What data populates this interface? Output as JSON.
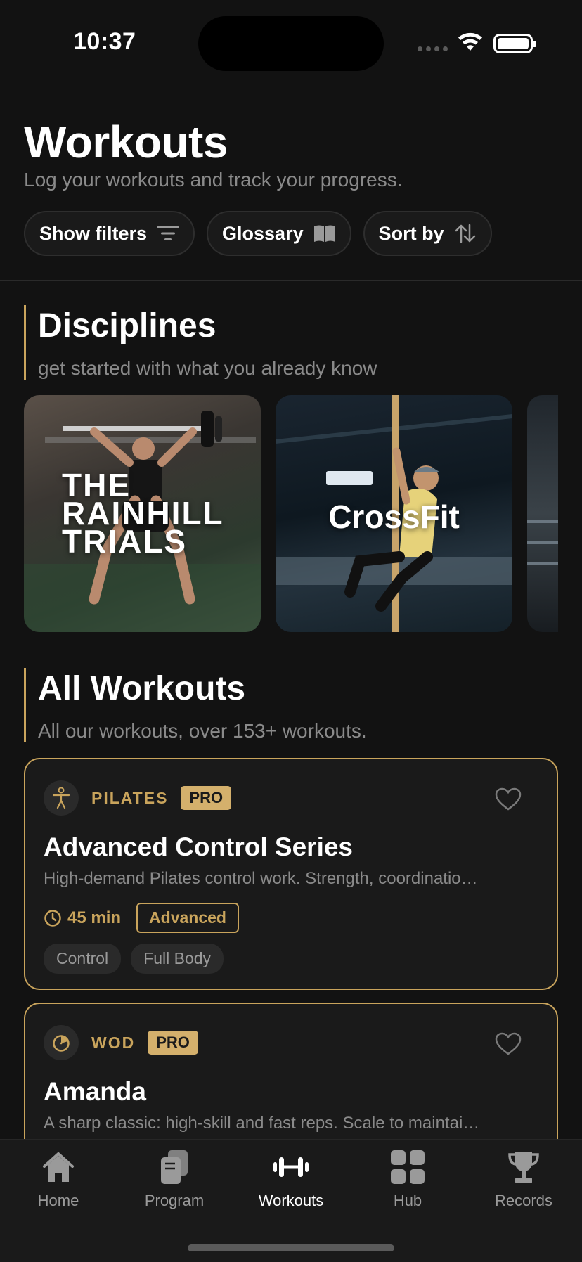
{
  "status_bar": {
    "time": "10:37"
  },
  "header": {
    "title": "Workouts",
    "subtitle": "Log your workouts and track your progress."
  },
  "filters": {
    "show_filters": "Show filters",
    "glossary": "Glossary",
    "sort_by": "Sort by"
  },
  "disciplines": {
    "title": "Disciplines",
    "subtitle": "get started with what you already know",
    "cards": [
      {
        "title": "THE RAINHILL TRIALS"
      },
      {
        "title": "CrossFit"
      }
    ]
  },
  "all_workouts": {
    "title": "All Workouts",
    "subtitle": "All our workouts, over 153+ workouts.",
    "items": [
      {
        "category": "PILATES",
        "badge": "PRO",
        "title": "Advanced Control Series",
        "description": "High-demand Pilates control work. Strength, coordinatio…",
        "duration": "45 min",
        "level": "Advanced",
        "tags": [
          "Control",
          "Full Body"
        ]
      },
      {
        "category": "WOD",
        "badge": "PRO",
        "title": "Amanda",
        "description": "A sharp classic: high-skill and fast reps. Scale to maintai…"
      }
    ]
  },
  "tab_bar": {
    "tabs": [
      {
        "label": "Home",
        "icon": "home-icon"
      },
      {
        "label": "Program",
        "icon": "program-icon"
      },
      {
        "label": "Workouts",
        "icon": "dumbbell-icon",
        "active": true
      },
      {
        "label": "Hub",
        "icon": "grid-icon"
      },
      {
        "label": "Records",
        "icon": "trophy-icon"
      }
    ]
  },
  "colors": {
    "accent": "#c9a45c",
    "background": "#121212",
    "card": "#1a1a1a"
  }
}
